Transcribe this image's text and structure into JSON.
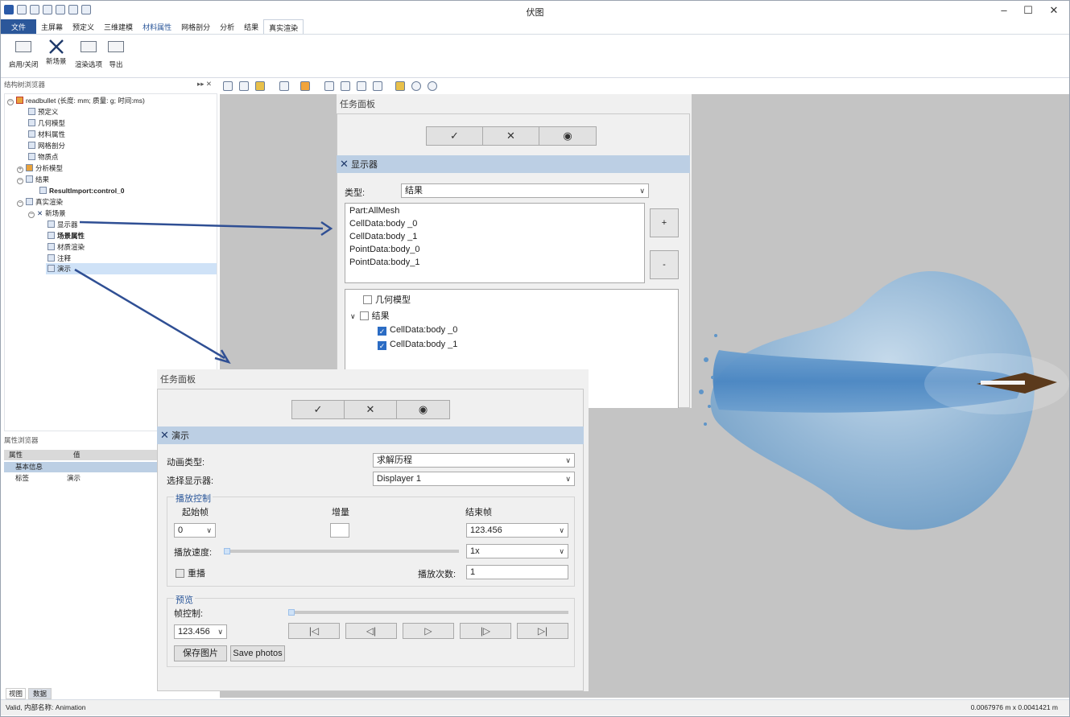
{
  "app": {
    "title": "伏图"
  },
  "window": {
    "minimize": "–",
    "maximize": "☐",
    "close": "✕"
  },
  "ribbon": {
    "tabs": [
      "文件",
      "主屏幕",
      "预定义",
      "三维建模",
      "材料属性",
      "网格剖分",
      "分析",
      "结果",
      "真实渲染"
    ],
    "active_tab": "真实渲染",
    "buttons": [
      "启用/关闭",
      "新场景",
      "渲染选项",
      "导出"
    ]
  },
  "tree_browser": {
    "header": "结构树浏览器",
    "root": "readbullet (长度: mm; 质量: g; 时间:ms)",
    "items": [
      "预定义",
      "几何模型",
      "材料属性",
      "网格剖分",
      "物质点",
      "分析模型",
      "结果",
      "ResultImport:control_0",
      "真实渲染",
      "新场景",
      "显示器",
      "场景属性",
      "材质渲染",
      "注释",
      "演示"
    ]
  },
  "prop_browser": {
    "header": "属性浏览器",
    "col_property": "属性",
    "col_value": "值",
    "group": "基本信息",
    "row_label": "标签",
    "row_value": "演示"
  },
  "bottom_tabs": [
    "视图",
    "数据"
  ],
  "status": {
    "left": "Valid, 内部名称: Animation",
    "right": "0.0067976 m x 0.0041421 m"
  },
  "panel1": {
    "title": "任务面板",
    "section": "显示器",
    "type_label": "类型:",
    "type_value": "结果",
    "list": [
      "Part:AllMesh",
      "CellData:body _0",
      "CellData:body _1",
      "PointData:body_0",
      "PointData:body_1"
    ],
    "add": "+",
    "remove": "-",
    "tree": [
      "几何模型",
      "结果",
      "CellData:body _0",
      "CellData:body _1"
    ]
  },
  "panel2": {
    "title": "任务面板",
    "section": "演示",
    "anim_type_label": "动画类型:",
    "anim_type_value": "求解历程",
    "displayer_label": "选择显示器:",
    "displayer_value": "Displayer 1",
    "play_group": "播放控制",
    "start_label": "起始帧",
    "inc_label": "增量",
    "end_label": "结束帧",
    "start_value": "0",
    "inc_value": "",
    "end_value": "123.456",
    "speed_label": "播放速度:",
    "speed_value": "1x",
    "replay_label": "重播",
    "count_label": "播放次数:",
    "count_value": "1",
    "preview_group": "预览",
    "frame_label": "帧控制:",
    "frame_value": "123.456",
    "save_image": "保存图片",
    "save_photos": "Save photos"
  }
}
